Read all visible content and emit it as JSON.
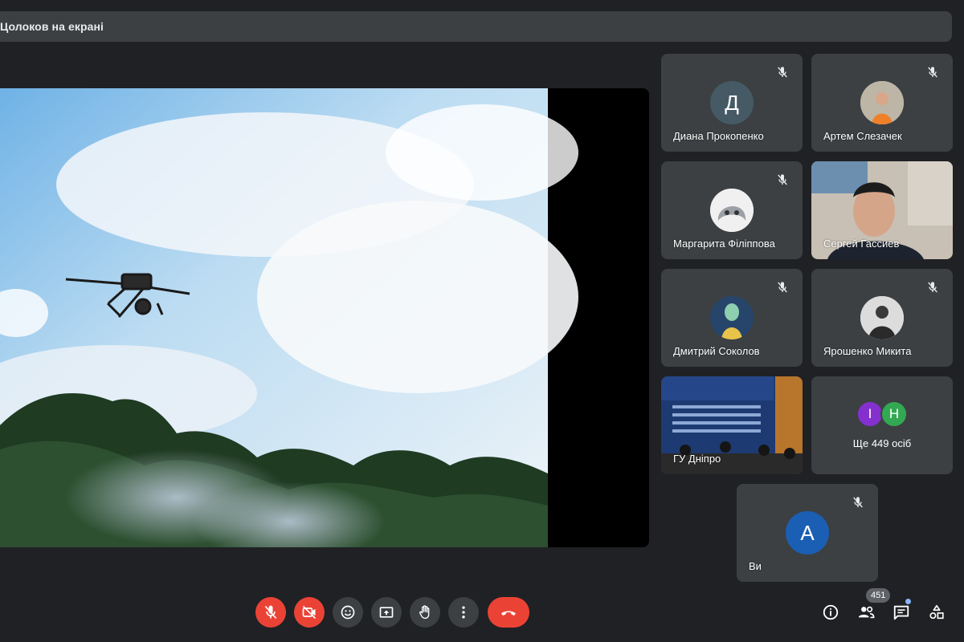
{
  "presenter": {
    "label": "Цолоков на екрані"
  },
  "tiles": [
    {
      "name": "Диана Прокопенко",
      "initial": "Д",
      "avatar_color": "#455a64",
      "muted": true
    },
    {
      "name": "Артем Слезачек",
      "muted": true
    },
    {
      "name": "Маргарита Філіппова",
      "muted": true
    },
    {
      "name": "Сергей Гассиев",
      "muted": false
    },
    {
      "name": "Дмитрий Соколов",
      "muted": true
    },
    {
      "name": "Ярошенко Микита",
      "muted": true
    },
    {
      "name": "ГУ Дніпро",
      "muted": false
    },
    {
      "more_label": "Ще 449 осіб",
      "mini": [
        {
          "initial": "І",
          "color": "#8430ce"
        },
        {
          "initial": "Н",
          "color": "#33a852"
        }
      ]
    },
    {
      "name": "Ви",
      "initial": "А",
      "avatar_color": "#1a5fb4",
      "muted": true
    }
  ],
  "toolbar": {
    "participants_count": "451"
  },
  "colors": {
    "background": "#202124",
    "tile": "#3c4043",
    "danger": "#ea4335",
    "accent": "#8ab4f8"
  },
  "icons": [
    "mic-off-icon",
    "camera-off-icon",
    "emoji-icon",
    "present-icon",
    "raise-hand-icon",
    "more-icon",
    "hangup-icon",
    "info-icon",
    "people-icon",
    "chat-icon",
    "activities-icon"
  ]
}
